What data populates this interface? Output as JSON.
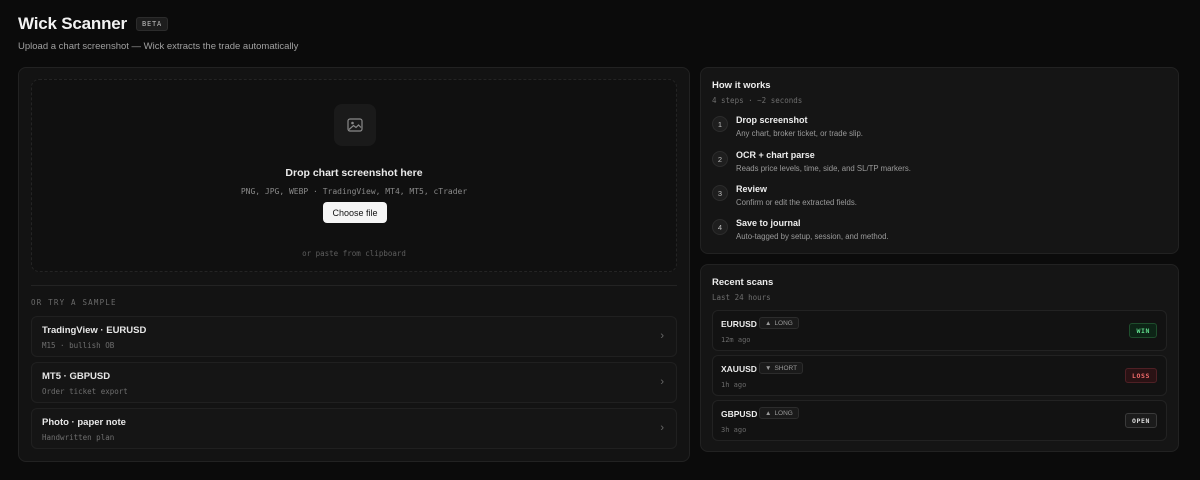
{
  "header": {
    "title": "Wick Scanner",
    "badge": "BETA",
    "subtitle": "Upload a chart screenshot — Wick extracts the trade automatically"
  },
  "upload": {
    "icon": "image-icon",
    "title": "Drop chart screenshot here",
    "formats": "PNG, JPG, WEBP · TradingView, MT4, MT5, cTrader",
    "button": "Choose file",
    "paste_hint": "or paste from clipboard"
  },
  "samples": {
    "heading": "OR TRY A SAMPLE",
    "items": [
      {
        "name": "TradingView · EURUSD",
        "desc": "M15 · bullish OB"
      },
      {
        "name": "MT5 · GBPUSD",
        "desc": "Order ticket export"
      },
      {
        "name": "Photo · paper note",
        "desc": "Handwritten plan"
      }
    ]
  },
  "how_it_works": {
    "title": "How it works",
    "meta": "4 steps · ~2 seconds",
    "steps": [
      {
        "num": "1",
        "title": "Drop screenshot",
        "desc": "Any chart, broker ticket, or trade slip."
      },
      {
        "num": "2",
        "title": "OCR + chart parse",
        "desc": "Reads price levels, time, side, and SL/TP markers."
      },
      {
        "num": "3",
        "title": "Review",
        "desc": "Confirm or edit the extracted fields."
      },
      {
        "num": "4",
        "title": "Save to journal",
        "desc": "Auto-tagged by setup, session, and method."
      }
    ]
  },
  "recent_scans": {
    "title": "Recent scans",
    "meta": "Last 24 hours",
    "rows": [
      {
        "pair": "EURUSD",
        "side": "LONG",
        "side_arrow": "▲",
        "time": "12m ago",
        "result": "WIN"
      },
      {
        "pair": "XAUUSD",
        "side": "SHORT",
        "side_arrow": "▼",
        "time": "1h ago",
        "result": "LOSS"
      },
      {
        "pair": "GBPUSD",
        "side": "LONG",
        "side_arrow": "▲",
        "time": "3h ago",
        "result": "OPEN"
      }
    ]
  },
  "colors": {
    "background": "#0b0b0b",
    "panel": "#131313",
    "win": "#5fd98a",
    "loss": "#f06a6a"
  }
}
